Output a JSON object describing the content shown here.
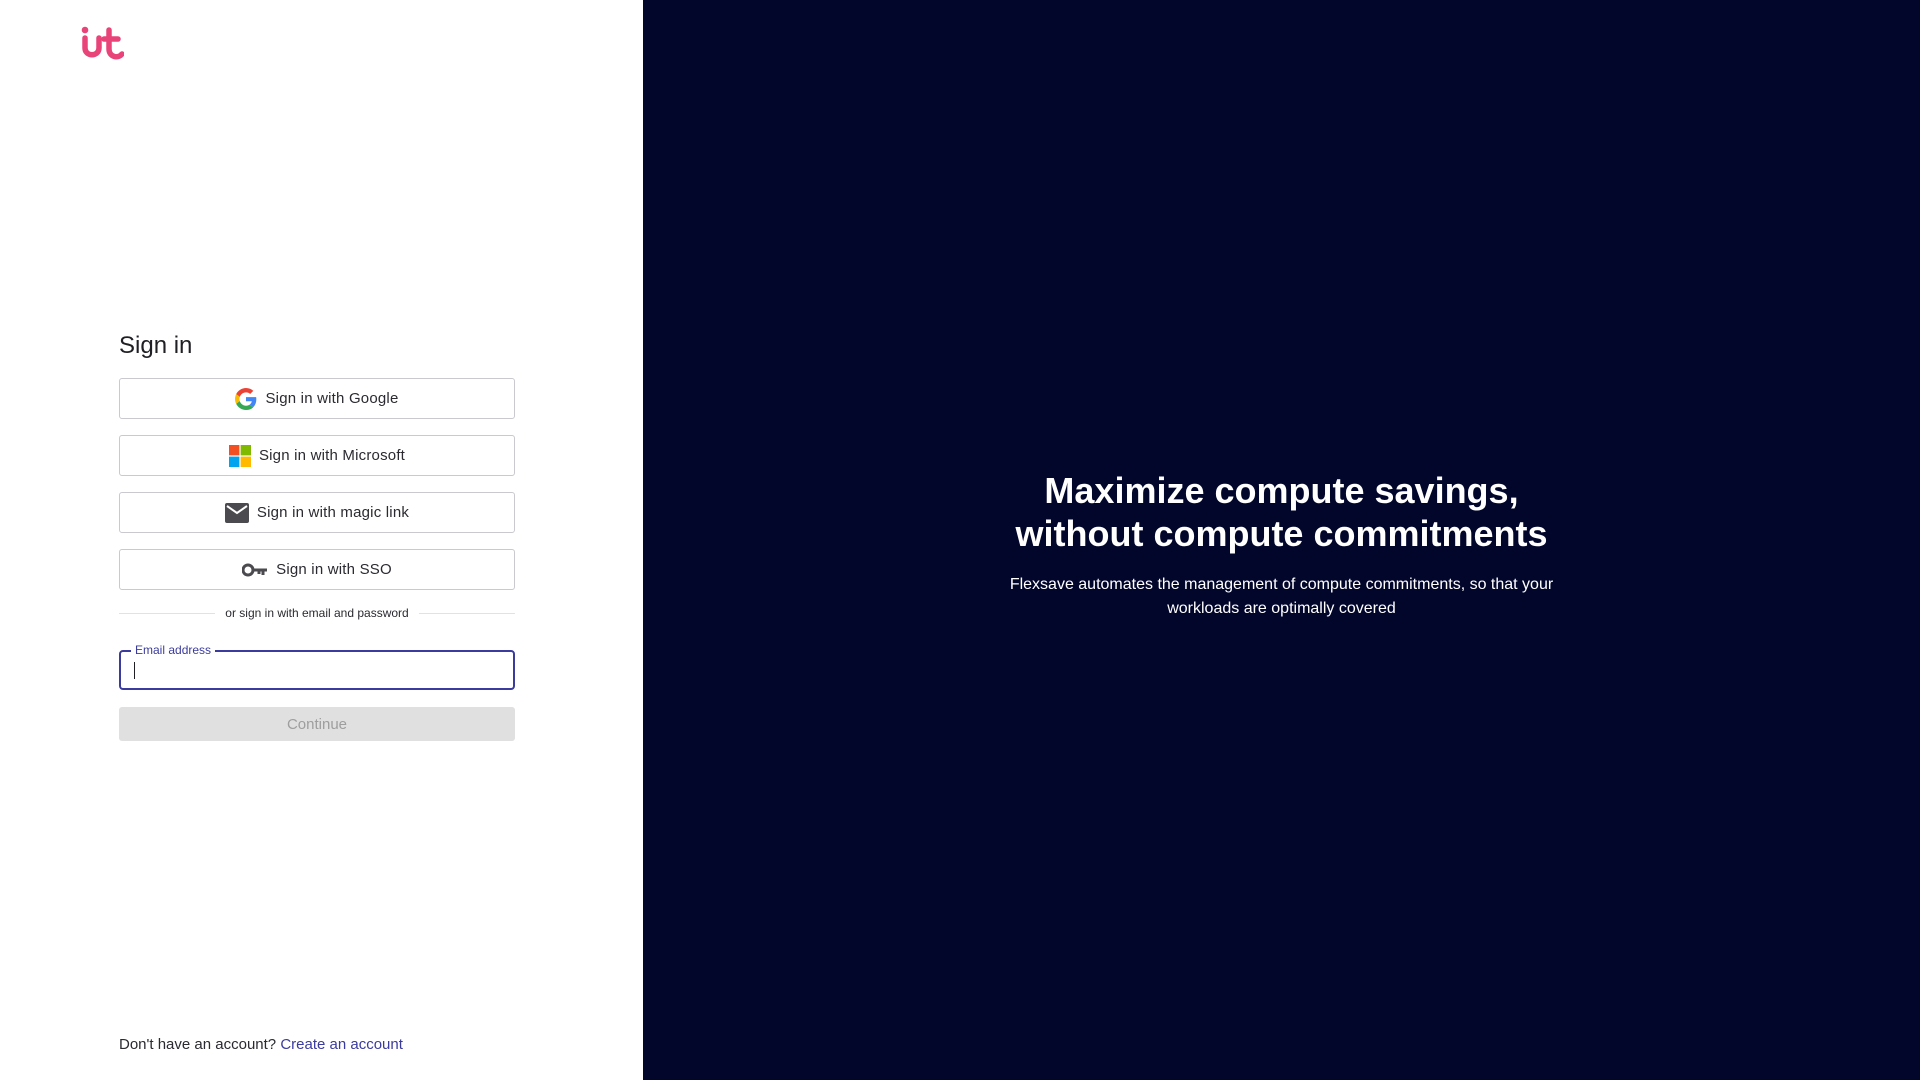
{
  "brand": {
    "logo_color": "#e8447a"
  },
  "signin": {
    "title": "Sign in",
    "google_label": "Sign in with Google",
    "microsoft_label": "Sign in with Microsoft",
    "magic_link_label": "Sign in with magic link",
    "sso_label": "Sign in with SSO",
    "divider_text": "or sign in with email and password",
    "email": {
      "label": "Email address",
      "value": "",
      "placeholder": ""
    },
    "continue_label": "Continue"
  },
  "footer": {
    "prompt": "Don't have an account?",
    "link": "Create an account"
  },
  "promo": {
    "headline": "Maximize compute savings, without compute commitments",
    "subline": "Flexsave automates the management of compute commitments, so that your workloads are optimally covered",
    "background": "#02062b"
  },
  "colors": {
    "accent": "#3b3b9e",
    "disabled_bg": "#e0e0e0",
    "disabled_text": "#9e9e9e"
  }
}
